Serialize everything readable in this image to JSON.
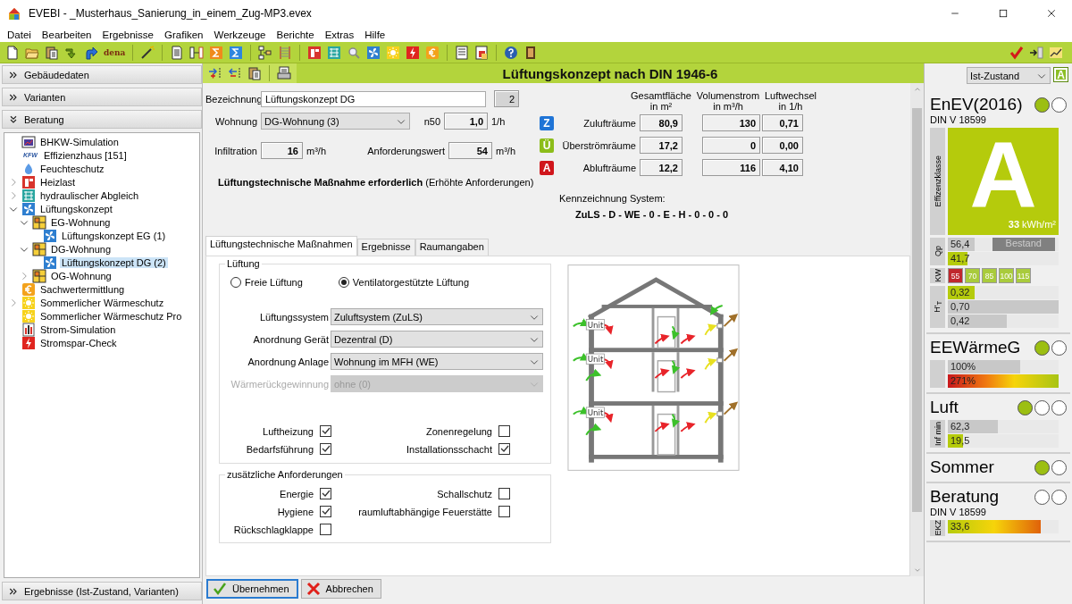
{
  "window": {
    "title": "EVEBI - _Musterhaus_Sanierung_in_einem_Zug-MP3.evex"
  },
  "menu": [
    {
      "label": "Datei"
    },
    {
      "label": "Bearbeiten"
    },
    {
      "label": "Ergebnisse"
    },
    {
      "label": "Grafiken"
    },
    {
      "label": "Werkzeuge"
    },
    {
      "label": "Berichte"
    },
    {
      "label": "Extras"
    },
    {
      "label": "Hilfe"
    }
  ],
  "toolbar": {
    "dena_label": "dena"
  },
  "sidebar": {
    "sections": [
      {
        "label": "Gebäudedaten",
        "expanded": false
      },
      {
        "label": "Varianten",
        "expanded": false
      },
      {
        "label": "Beratung",
        "expanded": true
      }
    ],
    "tree": [
      {
        "label": "BHKW-Simulation",
        "kind": "bhkw",
        "selected": false
      },
      {
        "label": "Effizienzhaus [151]",
        "kind": "kfw",
        "badge": "KFW",
        "selected": false
      },
      {
        "label": "Feuchteschutz",
        "kind": "drop",
        "selected": false
      },
      {
        "label": "Heizlast",
        "kind": "window",
        "expanded": false,
        "selected": false
      },
      {
        "label": "hydraulischer Abgleich",
        "kind": "network",
        "expanded": false,
        "selected": false
      },
      {
        "label": "Lüftungskonzept",
        "kind": "fan",
        "expanded": true,
        "selected": false,
        "children": [
          {
            "label": "EG-Wohnung",
            "kind": "plan",
            "expanded": true,
            "selected": false,
            "children": [
              {
                "label": "Lüftungskonzept EG (1)",
                "kind": "fan",
                "selected": false
              }
            ]
          },
          {
            "label": "DG-Wohnung",
            "kind": "plan",
            "expanded": true,
            "selected": false,
            "children": [
              {
                "label": "Lüftungskonzept DG (2)",
                "kind": "fan",
                "selected": true
              }
            ]
          },
          {
            "label": "OG-Wohnung",
            "kind": "plan",
            "expanded": false,
            "selected": false
          }
        ]
      },
      {
        "label": "Sachwertermittlung",
        "kind": "coin",
        "selected": false
      },
      {
        "label": "Sommerlicher Wärmeschutz",
        "kind": "sun",
        "expanded": false,
        "selected": false
      },
      {
        "label": "Sommerlicher Wärmeschutz Pro",
        "kind": "sun",
        "selected": false
      },
      {
        "label": "Strom-Simulation",
        "kind": "meter",
        "selected": false
      },
      {
        "label": "Stromspar-Check",
        "kind": "bolt",
        "selected": false
      }
    ],
    "footer": {
      "label": "Ergebnisse (Ist-Zustand, Varianten)",
      "expanded": false
    }
  },
  "form": {
    "title": "Lüftungskonzept nach DIN 1946-6",
    "bezeichnung": {
      "label": "Bezeichnung",
      "value": "Lüftungskonzept DG",
      "number": "2"
    },
    "wohnung": {
      "label": "Wohnung",
      "value": "DG-Wohnung (3)"
    },
    "n50": {
      "label": "n50",
      "value": "1,0",
      "unit": "1/h"
    },
    "infiltration": {
      "label": "Infiltration",
      "value": "16",
      "unit": "m³/h"
    },
    "anforderungswert": {
      "label": "Anforderungswert",
      "value": "54",
      "unit": "m³/h"
    },
    "notice": "**Lüftungstechnische Maßnahme erforderlich** (Erhöhte Anforderungen)",
    "rooms": {
      "columns": [
        [
          "Gesamtfläche",
          "in m²"
        ],
        [
          "Volumenstrom",
          "in m³/h"
        ],
        [
          "Luftwechsel",
          "in 1/h"
        ]
      ],
      "rows": [
        {
          "badge": "Z",
          "color": "#1f74d6",
          "label": "Zulufträume",
          "values": [
            "80,9",
            "130",
            "0,71"
          ]
        },
        {
          "badge": "Ü",
          "color": "#8cbd1a",
          "label": "Überströmräume",
          "values": [
            "17,2",
            "0",
            "0,00"
          ]
        },
        {
          "badge": "A",
          "color": "#d0161c",
          "label": "Ablufträume",
          "values": [
            "12,2",
            "116",
            "4,10"
          ]
        }
      ]
    },
    "system": {
      "label": "Kennzeichnung System:",
      "code": "ZuLS - D - WE - 0 - E - H - 0 - 0 - 0"
    }
  },
  "tabs": [
    {
      "label": "Lüftungstechnische Maßnahmen",
      "selected": true
    },
    {
      "label": "Ergebnisse",
      "selected": false
    },
    {
      "label": "Raumangaben",
      "selected": false
    }
  ],
  "lueftung": {
    "title": "Lüftung",
    "radios": [
      {
        "label": "Freie Lüftung",
        "selected": false
      },
      {
        "label": "Ventilatorgestützte Lüftung",
        "selected": true
      }
    ],
    "selects": [
      {
        "label": "Lüftungssystem",
        "value": "Zuluftsystem (ZuLS)",
        "disabled": false
      },
      {
        "label": "Anordnung Gerät",
        "value": "Dezentral (D)",
        "disabled": false
      },
      {
        "label": "Anordnung Anlage",
        "value": "Wohnung im MFH (WE)",
        "disabled": false
      },
      {
        "label": "Wärmerückgewinnung",
        "value": "ohne (0)",
        "disabled": true
      }
    ],
    "checks": [
      {
        "label": "Luftheizung",
        "checked": true
      },
      {
        "label": "Zonenregelung",
        "checked": false
      },
      {
        "label": "Bedarfsführung",
        "checked": true
      },
      {
        "label": "Installationsschacht",
        "checked": true
      }
    ]
  },
  "zusaetzlich": {
    "title": "zusätzliche Anforderungen",
    "checks": [
      {
        "label": "Energie",
        "checked": true
      },
      {
        "label": "Schallschutz",
        "checked": false
      },
      {
        "label": "Hygiene",
        "checked": true
      },
      {
        "label": "raumluftabhängige Feuerstätte",
        "checked": false
      },
      {
        "label": "Rückschlagklappe",
        "checked": false
      }
    ]
  },
  "diagram": {
    "unit_labels": [
      "Unit",
      "Unit",
      "Unit"
    ]
  },
  "buttons": [
    {
      "label": "Übernehmen",
      "kind": "ok"
    },
    {
      "label": "Abbrechen",
      "kind": "cancel"
    }
  ],
  "right": {
    "scenario": "Ist-Zustand",
    "class_button": "A",
    "sections": [
      {
        "title": "EnEV(2016)",
        "subtitle": "DIN V 18599",
        "lights": [
          {
            "on": true
          },
          {
            "on": false
          }
        ],
        "rows": [
          {
            "kind": "class",
            "label": "Effizenzklasse",
            "letter": "A",
            "value": "**33** kWh/m²"
          },
          {
            "kind": "bars",
            "label": "Qp",
            "tag": "Bestand",
            "bars": [
              {
                "text": "56,4",
                "level": 0.24,
                "kind": "grey"
              },
              {
                "text": "41,7",
                "level": 0.18,
                "kind": "green"
              }
            ]
          },
          {
            "kind": "scale",
            "label": "KW",
            "cells": [
              {
                "text": "55",
                "color": "#c0272d"
              },
              {
                "text": "70",
                "color": "#a9cb3c"
              },
              {
                "text": "85",
                "color": "#a9cb3c"
              },
              {
                "text": "100",
                "color": "#a9cb3c"
              },
              {
                "text": "115",
                "color": "#a9cb3c"
              }
            ]
          },
          {
            "kind": "bars",
            "label": "H'$_{T}$",
            "bars": [
              {
                "text": "0,32",
                "level": 0.24,
                "kind": "green"
              },
              {
                "text": "0,70",
                "level": 1.0,
                "kind": "grey"
              },
              {
                "text": "0,42",
                "level": 0.53,
                "kind": "grey"
              }
            ]
          }
        ]
      },
      {
        "title": "EEWärmeG",
        "lights": [
          {
            "on": true
          },
          {
            "on": false
          }
        ],
        "rows": [
          {
            "kind": "bars",
            "bars": [
              {
                "text": "100%",
                "level": 0.65,
                "kind": "grey"
              },
              {
                "text": "271%",
                "level": 1.0,
                "kind": "heat"
              }
            ]
          }
        ]
      },
      {
        "title": "Luft",
        "lights": [
          {
            "on": true
          },
          {
            "on": false
          },
          {
            "on": false
          }
        ],
        "rows": [
          {
            "kind": "bars",
            "label": "Inf min",
            "bars": [
              {
                "text": "62,3",
                "level": 0.45,
                "kind": "grey"
              },
              {
                "text": "19,5",
                "level": 0.14,
                "kind": "green"
              }
            ]
          }
        ]
      },
      {
        "title": "Sommer",
        "lights": [
          {
            "on": true
          },
          {
            "on": false
          }
        ]
      },
      {
        "title": "Beratung",
        "subtitle": "DIN V 18599",
        "lights": [
          {
            "on": false
          },
          {
            "on": false
          }
        ],
        "rows": [
          {
            "kind": "bars",
            "label": "EKZ",
            "bars": [
              {
                "text": "33,6",
                "level": 0.84,
                "kind": "cool"
              }
            ]
          }
        ]
      }
    ]
  }
}
